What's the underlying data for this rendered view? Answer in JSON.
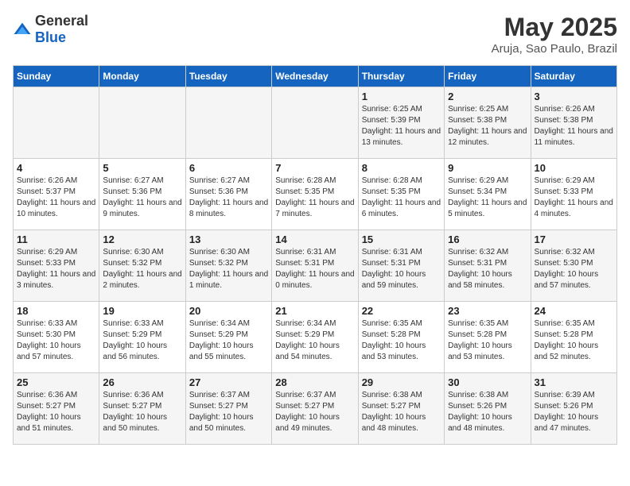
{
  "header": {
    "logo_general": "General",
    "logo_blue": "Blue",
    "title": "May 2025",
    "subtitle": "Aruja, Sao Paulo, Brazil"
  },
  "calendar": {
    "days_of_week": [
      "Sunday",
      "Monday",
      "Tuesday",
      "Wednesday",
      "Thursday",
      "Friday",
      "Saturday"
    ],
    "weeks": [
      [
        {
          "day": "",
          "info": ""
        },
        {
          "day": "",
          "info": ""
        },
        {
          "day": "",
          "info": ""
        },
        {
          "day": "",
          "info": ""
        },
        {
          "day": "1",
          "info": "Sunrise: 6:25 AM\nSunset: 5:39 PM\nDaylight: 11 hours and 13 minutes."
        },
        {
          "day": "2",
          "info": "Sunrise: 6:25 AM\nSunset: 5:38 PM\nDaylight: 11 hours and 12 minutes."
        },
        {
          "day": "3",
          "info": "Sunrise: 6:26 AM\nSunset: 5:38 PM\nDaylight: 11 hours and 11 minutes."
        }
      ],
      [
        {
          "day": "4",
          "info": "Sunrise: 6:26 AM\nSunset: 5:37 PM\nDaylight: 11 hours and 10 minutes."
        },
        {
          "day": "5",
          "info": "Sunrise: 6:27 AM\nSunset: 5:36 PM\nDaylight: 11 hours and 9 minutes."
        },
        {
          "day": "6",
          "info": "Sunrise: 6:27 AM\nSunset: 5:36 PM\nDaylight: 11 hours and 8 minutes."
        },
        {
          "day": "7",
          "info": "Sunrise: 6:28 AM\nSunset: 5:35 PM\nDaylight: 11 hours and 7 minutes."
        },
        {
          "day": "8",
          "info": "Sunrise: 6:28 AM\nSunset: 5:35 PM\nDaylight: 11 hours and 6 minutes."
        },
        {
          "day": "9",
          "info": "Sunrise: 6:29 AM\nSunset: 5:34 PM\nDaylight: 11 hours and 5 minutes."
        },
        {
          "day": "10",
          "info": "Sunrise: 6:29 AM\nSunset: 5:33 PM\nDaylight: 11 hours and 4 minutes."
        }
      ],
      [
        {
          "day": "11",
          "info": "Sunrise: 6:29 AM\nSunset: 5:33 PM\nDaylight: 11 hours and 3 minutes."
        },
        {
          "day": "12",
          "info": "Sunrise: 6:30 AM\nSunset: 5:32 PM\nDaylight: 11 hours and 2 minutes."
        },
        {
          "day": "13",
          "info": "Sunrise: 6:30 AM\nSunset: 5:32 PM\nDaylight: 11 hours and 1 minute."
        },
        {
          "day": "14",
          "info": "Sunrise: 6:31 AM\nSunset: 5:31 PM\nDaylight: 11 hours and 0 minutes."
        },
        {
          "day": "15",
          "info": "Sunrise: 6:31 AM\nSunset: 5:31 PM\nDaylight: 10 hours and 59 minutes."
        },
        {
          "day": "16",
          "info": "Sunrise: 6:32 AM\nSunset: 5:31 PM\nDaylight: 10 hours and 58 minutes."
        },
        {
          "day": "17",
          "info": "Sunrise: 6:32 AM\nSunset: 5:30 PM\nDaylight: 10 hours and 57 minutes."
        }
      ],
      [
        {
          "day": "18",
          "info": "Sunrise: 6:33 AM\nSunset: 5:30 PM\nDaylight: 10 hours and 57 minutes."
        },
        {
          "day": "19",
          "info": "Sunrise: 6:33 AM\nSunset: 5:29 PM\nDaylight: 10 hours and 56 minutes."
        },
        {
          "day": "20",
          "info": "Sunrise: 6:34 AM\nSunset: 5:29 PM\nDaylight: 10 hours and 55 minutes."
        },
        {
          "day": "21",
          "info": "Sunrise: 6:34 AM\nSunset: 5:29 PM\nDaylight: 10 hours and 54 minutes."
        },
        {
          "day": "22",
          "info": "Sunrise: 6:35 AM\nSunset: 5:28 PM\nDaylight: 10 hours and 53 minutes."
        },
        {
          "day": "23",
          "info": "Sunrise: 6:35 AM\nSunset: 5:28 PM\nDaylight: 10 hours and 53 minutes."
        },
        {
          "day": "24",
          "info": "Sunrise: 6:35 AM\nSunset: 5:28 PM\nDaylight: 10 hours and 52 minutes."
        }
      ],
      [
        {
          "day": "25",
          "info": "Sunrise: 6:36 AM\nSunset: 5:27 PM\nDaylight: 10 hours and 51 minutes."
        },
        {
          "day": "26",
          "info": "Sunrise: 6:36 AM\nSunset: 5:27 PM\nDaylight: 10 hours and 50 minutes."
        },
        {
          "day": "27",
          "info": "Sunrise: 6:37 AM\nSunset: 5:27 PM\nDaylight: 10 hours and 50 minutes."
        },
        {
          "day": "28",
          "info": "Sunrise: 6:37 AM\nSunset: 5:27 PM\nDaylight: 10 hours and 49 minutes."
        },
        {
          "day": "29",
          "info": "Sunrise: 6:38 AM\nSunset: 5:27 PM\nDaylight: 10 hours and 48 minutes."
        },
        {
          "day": "30",
          "info": "Sunrise: 6:38 AM\nSunset: 5:26 PM\nDaylight: 10 hours and 48 minutes."
        },
        {
          "day": "31",
          "info": "Sunrise: 6:39 AM\nSunset: 5:26 PM\nDaylight: 10 hours and 47 minutes."
        }
      ]
    ]
  }
}
